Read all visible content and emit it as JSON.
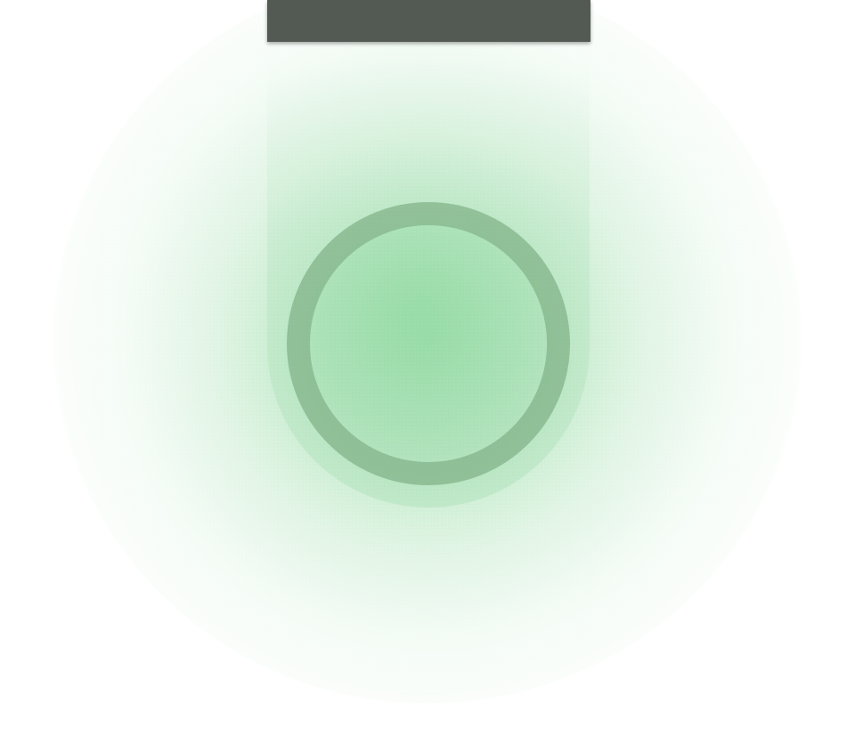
{
  "colors": {
    "background": "#ffffff",
    "glow_green": "#60c878",
    "top_bar": "#535a54",
    "ring": "#6ea073"
  },
  "top_bar": {
    "icon": "none"
  },
  "ring_button": {
    "icon": "circle-ring-icon"
  }
}
